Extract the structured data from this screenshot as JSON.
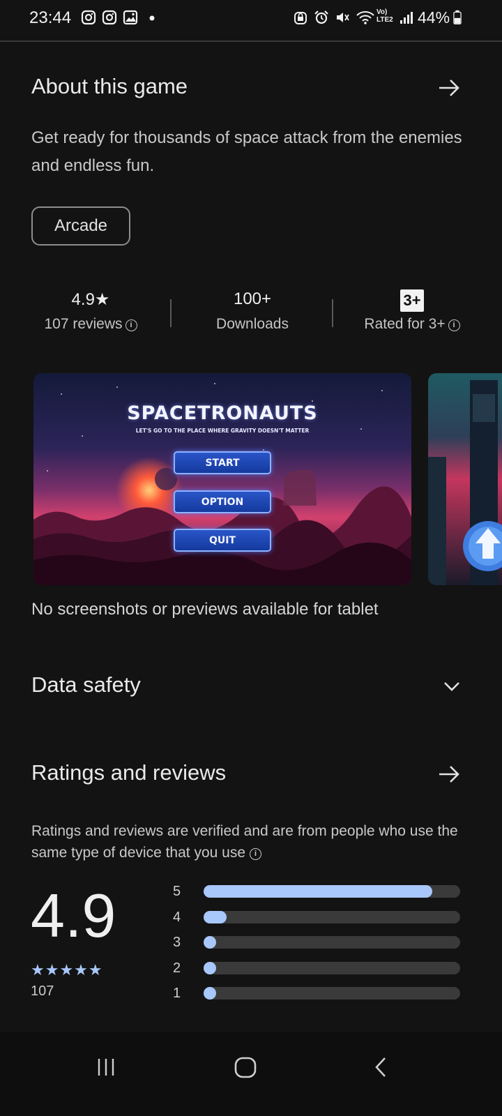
{
  "status_bar": {
    "time": "23:44",
    "battery_percent": "44%",
    "network_label": "Vo) LTE2",
    "left_icons": [
      "instagram-icon",
      "instagram-icon",
      "gallery-icon",
      "dot-icon"
    ],
    "right_icons": [
      "lock-icon",
      "alarm-icon",
      "mute-icon",
      "wifi-icon",
      "signal-icon",
      "battery-icon"
    ]
  },
  "about": {
    "title": "About this game",
    "description": "Get ready for thousands of space attack from the enemies and endless fun.",
    "chip": "Arcade"
  },
  "stats": {
    "rating": "4.9",
    "rating_star": "★",
    "reviews": "107 reviews",
    "downloads": "100+",
    "downloads_label": "Downloads",
    "content_rating_badge": "3+",
    "content_rating": "Rated for 3+"
  },
  "screenshot": {
    "game_title": "SPACETRONAUTS",
    "game_subtitle": "LET'S GO TO THE PLACE WHERE GRAVITY DOESN'T MATTER",
    "buttons": [
      "START",
      "OPTION",
      "QUIT"
    ]
  },
  "no_screenshots_text": "No screenshots or previews available for tablet",
  "data_safety": {
    "title": "Data safety"
  },
  "ratings": {
    "title": "Ratings and reviews",
    "note": "Ratings and reviews are verified and are from people who use the same type of device that you use",
    "average": "4.9",
    "stars_display": "★★★★★",
    "count": "107",
    "distribution": [
      {
        "label": "5",
        "fraction": 0.89
      },
      {
        "label": "4",
        "fraction": 0.09
      },
      {
        "label": "3",
        "fraction": 0.01
      },
      {
        "label": "2",
        "fraction": 0.01
      },
      {
        "label": "1",
        "fraction": 0.01
      }
    ]
  },
  "colors": {
    "background": "#131313",
    "accent": "#a8c7fa",
    "text_primary": "#eaeaea",
    "text_secondary": "#c9c9c9"
  },
  "nav_bar": {
    "icons": [
      "recent-apps-icon",
      "home-icon",
      "back-icon"
    ]
  }
}
